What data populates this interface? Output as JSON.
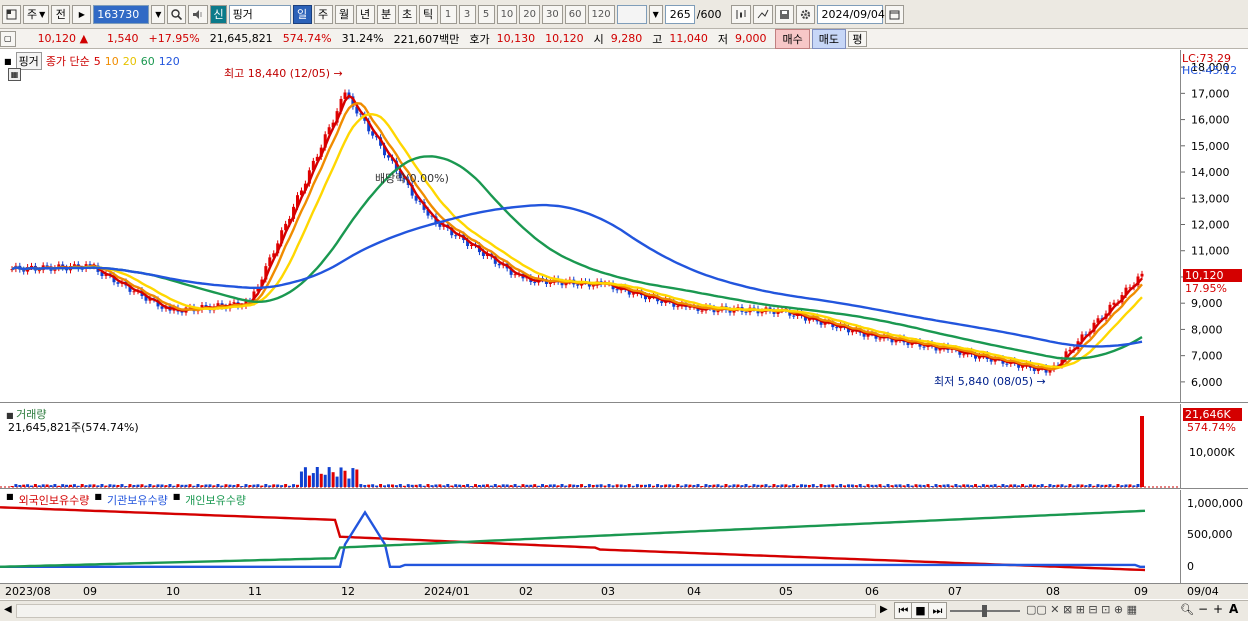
{
  "toolbar": {
    "period_select": "주",
    "prev_label": "전",
    "code": "163730",
    "market_badge": "신",
    "stock_name": "핑거",
    "periods": [
      "일",
      "주",
      "월",
      "년",
      "분",
      "초",
      "틱"
    ],
    "active_period": "일",
    "intervals": [
      "1",
      "3",
      "5",
      "10",
      "20",
      "30",
      "60",
      "120"
    ],
    "count": "265",
    "count_max": "/600",
    "date": "2024/09/04"
  },
  "quote": {
    "price": "10,120",
    "change": "1,540",
    "change_pct": "+17.95%",
    "volume": "21,645,821",
    "vol_ratio": "574.74%",
    "turnover": "31.24%",
    "amount": "221,607백만",
    "bid_label": "호가",
    "bid1": "10,130",
    "bid2": "10,120",
    "open_label": "시",
    "open": "9,280",
    "high_label": "고",
    "high": "11,040",
    "low_label": "저",
    "low": "9,000",
    "buy_btn": "매수",
    "sell_btn": "매도",
    "eval_btn": "평"
  },
  "price_panel": {
    "name_tag": "핑거",
    "ma_label": "종가 단순",
    "ma_periods": [
      "5",
      "10",
      "20",
      "60",
      "120"
    ],
    "ma_colors": [
      "#d40000",
      "#f08c00",
      "#ffd700",
      "#1a9850",
      "#2255dd"
    ],
    "lc": "LC:73.29",
    "hc": "HC:-45.12",
    "high_note": "최고 18,440 (12/05)",
    "low_note": "최저 5,840 (08/05)",
    "dividend_note": "배당락(0.00%)",
    "last_price": "10,120",
    "last_pct": "17.95%",
    "yticks": [
      "18,000",
      "17,000",
      "16,000",
      "15,000",
      "14,000",
      "13,000",
      "12,000",
      "11,000",
      "10,000",
      "9,000",
      "8,000",
      "7,000",
      "6,000"
    ]
  },
  "volume_panel": {
    "title": "거래량",
    "value": "21,645,821주(574.74%)",
    "last": "21,646K",
    "last_pct": "574.74%",
    "ytick": "10,000K"
  },
  "holding_panel": {
    "series": [
      "외국인보유수량",
      "기관보유수량",
      "개인보유수량"
    ],
    "colors": [
      "#d40000",
      "#2255dd",
      "#1a9850"
    ],
    "yticks": [
      "1,000,000",
      "500,000",
      "0"
    ]
  },
  "xaxis": {
    "labels": [
      "2023/08",
      "09",
      "10",
      "11",
      "12",
      "2024/01",
      "02",
      "03",
      "04",
      "05",
      "06",
      "07",
      "08",
      "09",
      "09/04"
    ]
  },
  "chart_data": {
    "type": "line",
    "title": "",
    "x": [
      "2023/08",
      "09",
      "10",
      "11",
      "12",
      "2024/01",
      "02",
      "03",
      "04",
      "05",
      "06",
      "07",
      "08",
      "09"
    ],
    "series": [
      {
        "name": "종가",
        "values": [
          10300,
          10400,
          8700,
          9000,
          17000,
          12300,
          9900,
          9700,
          8800,
          8700,
          7800,
          7200,
          6400,
          10120
        ]
      }
    ],
    "ylim": [
      5500,
      18500
    ]
  }
}
